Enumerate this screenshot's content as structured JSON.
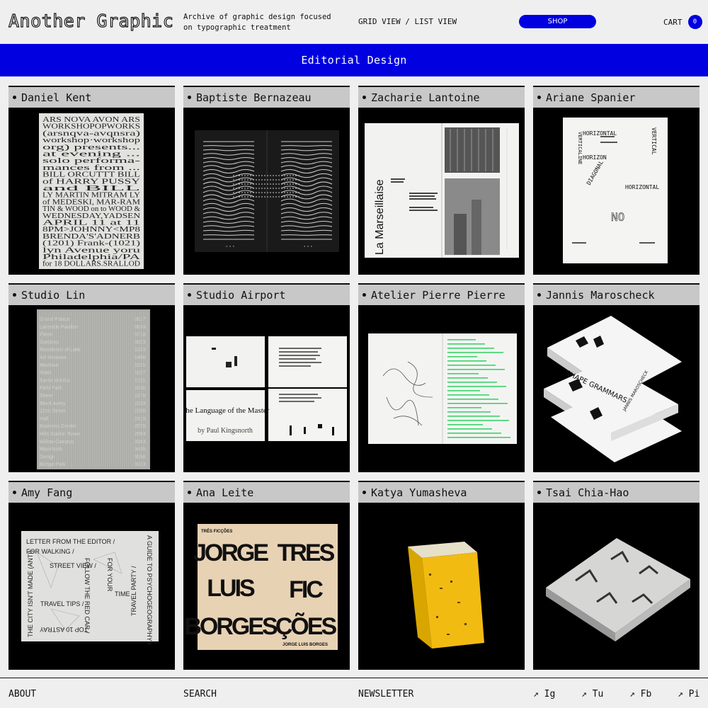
{
  "header": {
    "logo": "Another Graphic",
    "tagline_line1": "Archive of graphic design focused",
    "tagline_line2": "on typographic treatment",
    "grid_view": "GRID VIEW",
    "separator": " / ",
    "list_view": "LIST VIEW",
    "shop": "SHOP",
    "cart": "CART",
    "cart_count": "0"
  },
  "banner": {
    "title": "Editorial Design"
  },
  "cards": [
    {
      "name": "Daniel Kent"
    },
    {
      "name": "Baptiste Bernazeau"
    },
    {
      "name": "Zacharie Lantoine"
    },
    {
      "name": "Ariane Spanier"
    },
    {
      "name": "Studio Lin"
    },
    {
      "name": "Studio Airport"
    },
    {
      "name": "Atelier Pierre Pierre"
    },
    {
      "name": "Jannis Maroscheck"
    },
    {
      "name": "Amy Fang"
    },
    {
      "name": "Ana Leite"
    },
    {
      "name": "Katya Yumasheva"
    },
    {
      "name": "Tsai Chia-Hao"
    }
  ],
  "images": {
    "kent_lines": [
      "ARS    NOVA AVON   ARS",
      "WORKSHOPOPWORKS",
      "(arsnqva-avqnsra)",
      "workshop·workshop",
      "org) presents...",
      "at evening ...",
      "solo performa-",
      "mances from ...",
      "BILL ORCUTTT BILL",
      "of HARRY PUSSY",
      "and BILL",
      "LY MARTIN MITRAM LY",
      "of MEDESKI, MAR-RAM",
      "TIN & WOOD on to WOOD &",
      "WEDNESDAY,YADSEN",
      "APRIL 11 at 11",
      "8PM>JOHNNY<MP8",
      "BRENDA'S'ADNERB",
      "(1201) Frank-(1021)",
      "lyn Avenue yoru",
      "Philadelphia/PA",
      "for 18 DOLLARS.SRALLOD"
    ],
    "zacharie_title": "La Marseillaise",
    "spanier_words": [
      "HORIZONTAL",
      "HORIZON",
      "HORIZONTAL",
      "VERTICAL",
      "VERTICALINE",
      "DIAGONAL",
      "NO"
    ],
    "airport_title": "The Language of the Master",
    "airport_sub": "by Paul Kingsnorth",
    "jannis_title": "SHAPE GRAMMARS",
    "jannis_author": "JANNIS MAROSCHECK",
    "fang_lines": [
      "LETTER FROM THE EDITOR /",
      "FOR WALKING /",
      "STREET VIEW /",
      "FOR YOUR",
      "TIME",
      "TRAVEL TIPS /",
      "TOP 10 ASTRAY",
      "FOLLOW THE RED CAR /",
      "THE CITY ISN'T MADE (ANTI)",
      "A GUIDE TO PSYCHOGEOGRAPHY /",
      "TRAVEL PARTY /"
    ],
    "leite_left_top": "TRÊS FICÇÕES",
    "leite_left_big": [
      "JORGE",
      "LUIS",
      "BORGES"
    ],
    "leite_right_big": [
      "TRES",
      "FIC",
      "ÇÕES"
    ],
    "leite_right_bottom": "JORGE LUIS BORGES",
    "studio_lin_lines": [
      "Grand Palace",
      "Lakeside Pavilion",
      "Pierre",
      "Gardens",
      "Residence of Lake",
      "Art Museum",
      "Machine",
      "Hotel",
      "Santa Monica",
      "Field Park",
      "Street",
      "Block Avery",
      "22nd Street",
      "Hall",
      "Business Center",
      "Hills Station Tower",
      "Willow Campus",
      "Macintosh",
      "Design",
      "Bridge Park"
    ],
    "studio_lin_nums": [
      "0617",
      "0633",
      "0718",
      "0923",
      "1223",
      "1456",
      "1521",
      "1627",
      "1721",
      "1830",
      "1976",
      "2233",
      "2355",
      "2419",
      "2570",
      "2993",
      "3163",
      "3435",
      "3556",
      "3723"
    ]
  },
  "footer": {
    "about": "ABOUT",
    "search": "SEARCH",
    "newsletter": "NEWSLETTER",
    "social": [
      {
        "arrow": "↗",
        "label": "Ig"
      },
      {
        "arrow": "↗",
        "label": "Tu"
      },
      {
        "arrow": "↗",
        "label": "Fb"
      },
      {
        "arrow": "↗",
        "label": "Pi"
      }
    ]
  },
  "colors": {
    "accent": "#0000e0",
    "background": "#efefef",
    "card_header": "#c8c8c8"
  }
}
